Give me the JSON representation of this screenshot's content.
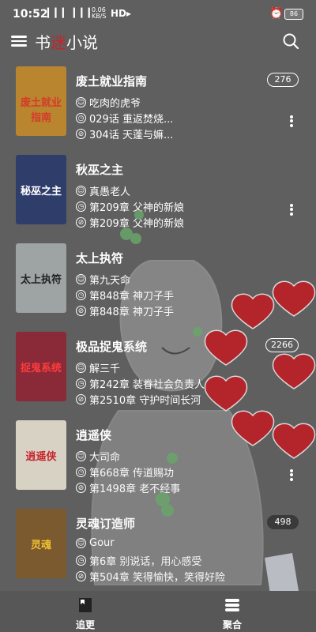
{
  "status": {
    "time": "10:52",
    "signal": "▎▎▎ ▎▎▎",
    "speed_top": "0.06",
    "speed_bottom": "KB/S",
    "hd": "HD▸",
    "battery": "86"
  },
  "header": {
    "logo_part1": "书",
    "logo_part2": "迷",
    "logo_part3": "小说"
  },
  "books": [
    {
      "title": "废土就业指南",
      "author": "吃肉的虎爷",
      "latest": "029话 重返焚烧...",
      "read": "304话 天蓬与嫲...",
      "badge": "276",
      "cover_text": "废土就业指南",
      "cover_color": "#b9862f",
      "cover_text_color": "#d63a2a"
    },
    {
      "title": "秋巫之主",
      "author": "真愚老人",
      "latest": "第209章 父神的新娘",
      "read": "第209章 父神的新娘",
      "badge": "",
      "cover_text": "秘巫之主",
      "cover_color": "#2e3d6a",
      "cover_text_color": "#ffffff"
    },
    {
      "title": "太上执符",
      "author": "第九天命",
      "latest": "第848章 神刀子手",
      "read": "第848章 神刀子手",
      "badge": "",
      "cover_text": "太上执符",
      "cover_color": "#9ea3a3",
      "cover_text_color": "#222222"
    },
    {
      "title": "极品捉鬼系统",
      "author": "解三千",
      "latest": "第242章 装眷社会负责人",
      "read": "第2510章 守护时间长河",
      "badge": "2266",
      "cover_text": "捉鬼系统",
      "cover_color": "#8a2a38",
      "cover_text_color": "#ff3b3b"
    },
    {
      "title": "逍遥侠",
      "author": "大司命",
      "latest": "第668章 传道赐功",
      "read": "第1498章 老不经事",
      "badge": "",
      "cover_text": "逍遥侠",
      "cover_color": "#d8d2c4",
      "cover_text_color": "#c8232b"
    },
    {
      "title": "灵魂订造师",
      "author": "Gour",
      "latest": "第6章 别说话，用心感受",
      "read": "第504章 笑得愉快，笑得好险",
      "badge": "498",
      "cover_text": "灵魂",
      "cover_color": "#7a5a2e",
      "cover_text_color": "#f1c232"
    }
  ],
  "tabs": {
    "following": "追更",
    "aggregate": "聚合"
  },
  "colors": {
    "background": "#5f5f5f",
    "logo_accent": "#c8232b",
    "heart": "#b3252b"
  }
}
